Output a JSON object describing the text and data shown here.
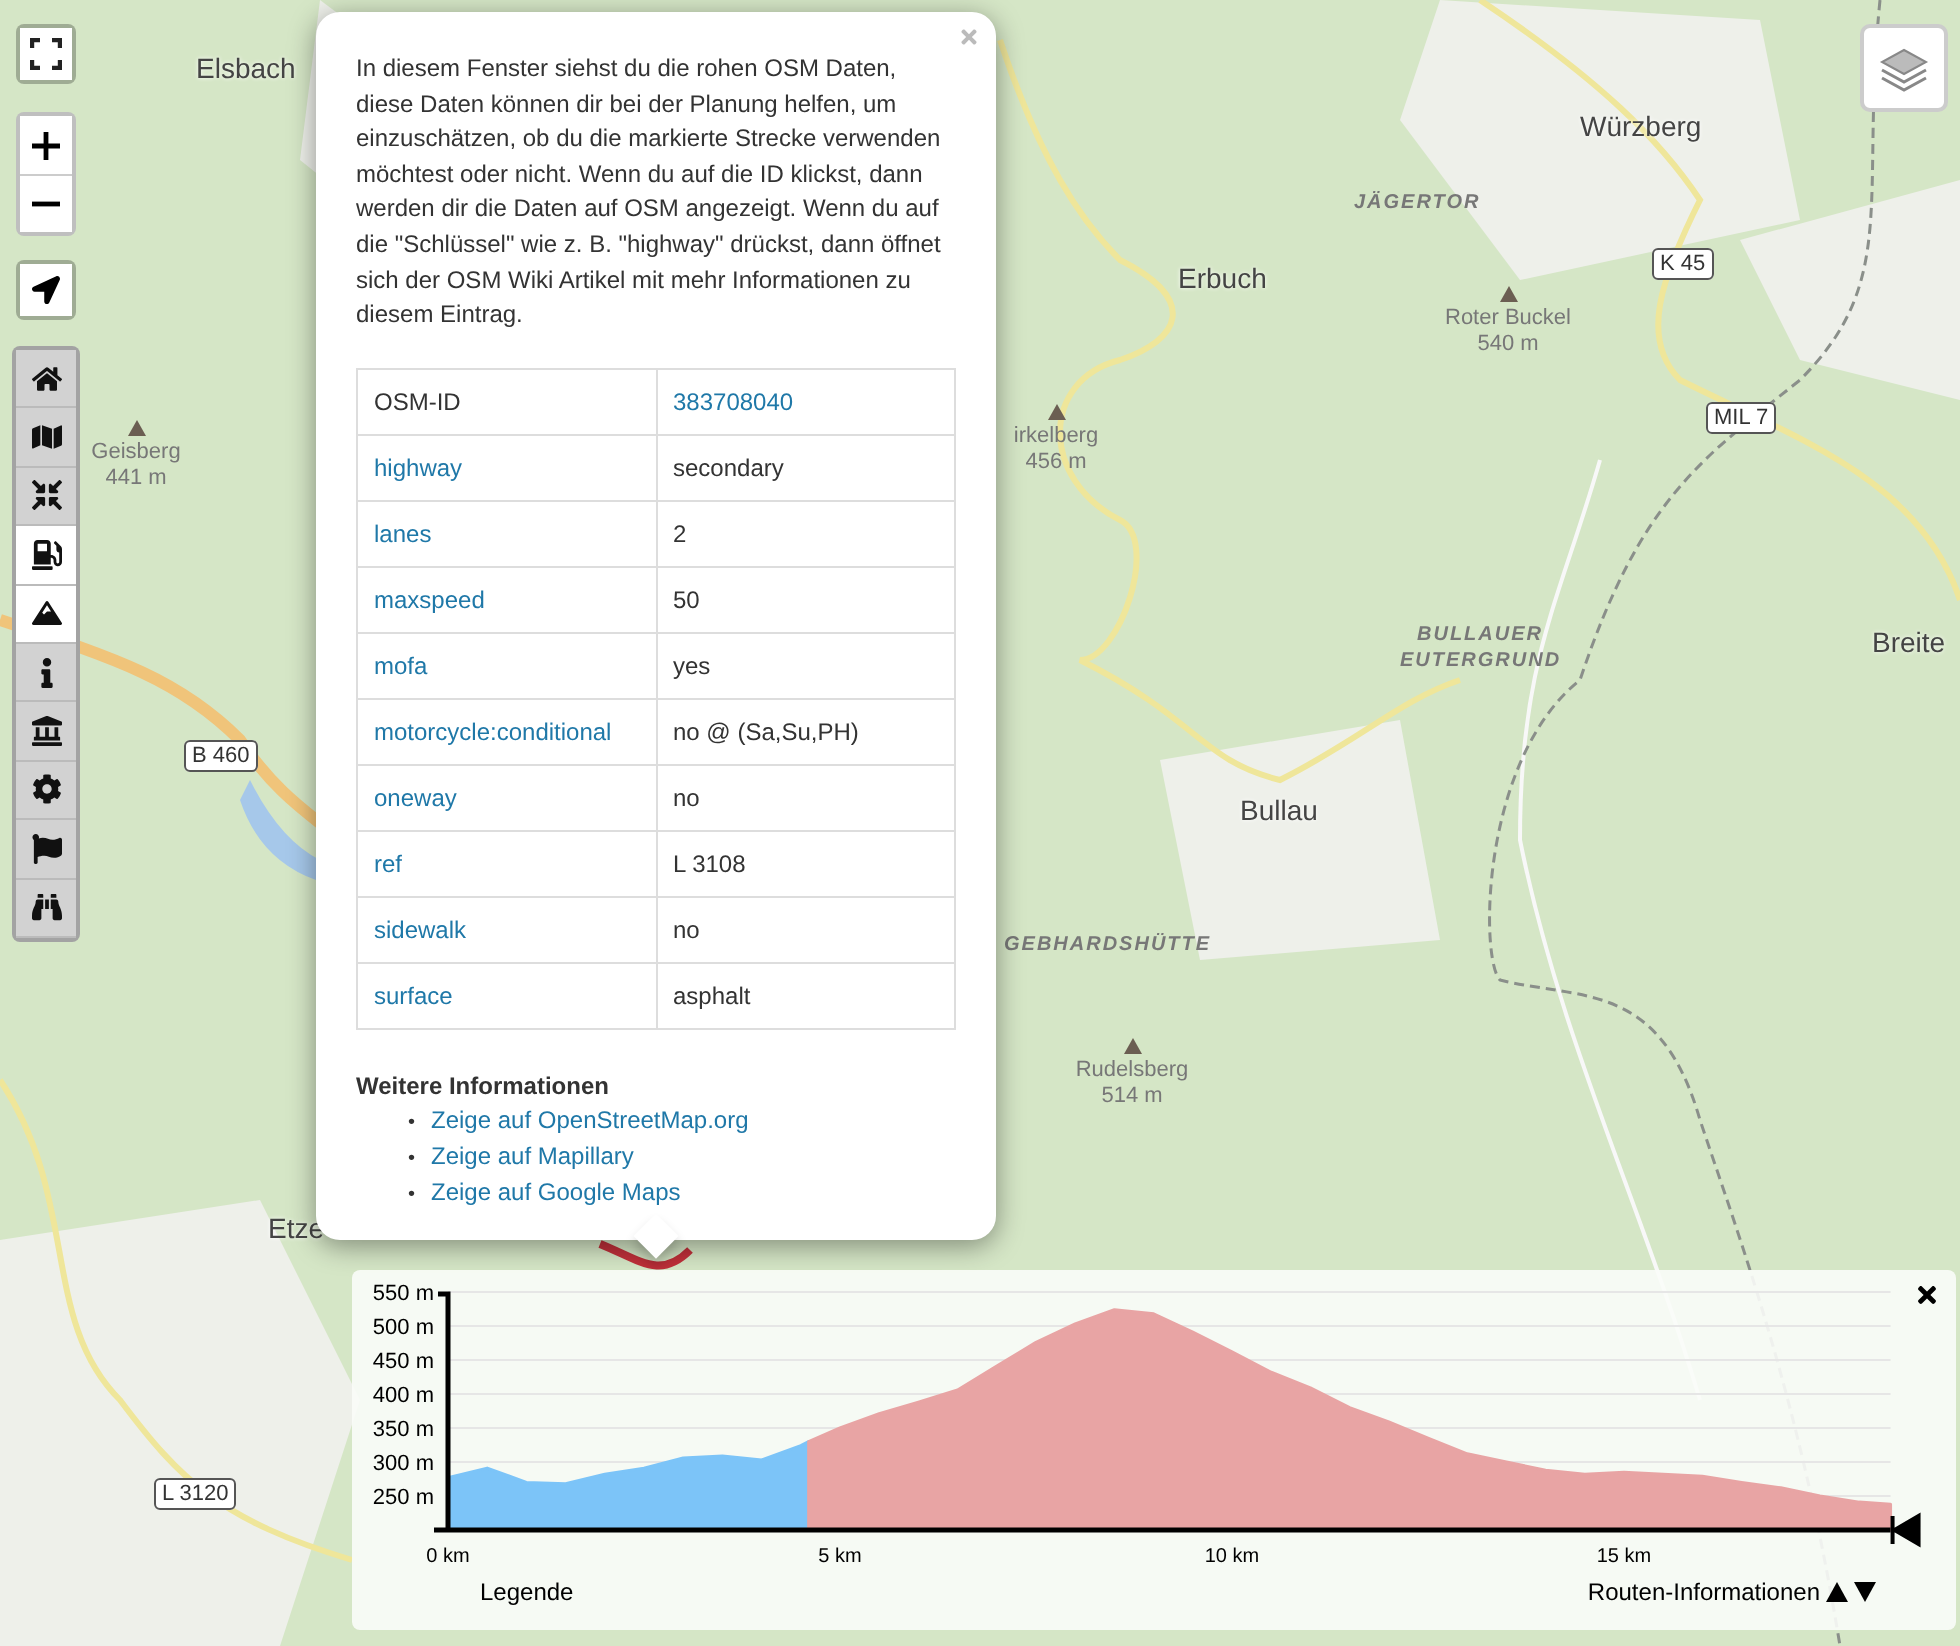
{
  "map": {
    "labels": [
      {
        "kind": "place",
        "text": "Elsbach"
      },
      {
        "kind": "peak",
        "text": "Geisberg",
        "elevation": "441 m"
      },
      {
        "kind": "road",
        "text": "B 460"
      },
      {
        "kind": "place",
        "text": "Etze"
      },
      {
        "kind": "road",
        "text": "L 3120"
      },
      {
        "kind": "place",
        "text": "Erbuch"
      },
      {
        "kind": "peak",
        "text": "irkelberg",
        "elevation": "456 m"
      },
      {
        "kind": "place",
        "text": "Würzberg"
      },
      {
        "kind": "area",
        "text": "JÄGERTOR"
      },
      {
        "kind": "peak",
        "text": "Roter Buckel",
        "elevation": "540 m"
      },
      {
        "kind": "road",
        "text": "K 45"
      },
      {
        "kind": "road",
        "text": "MIL 7"
      },
      {
        "kind": "place",
        "text": "Breite"
      },
      {
        "kind": "area",
        "text": "BULLAUER EUTERGRUND"
      },
      {
        "kind": "place",
        "text": "Bullau"
      },
      {
        "kind": "area",
        "text": "GEBHARDSHÜTTE"
      },
      {
        "kind": "peak",
        "text": "Rudelsberg",
        "elevation": "514 m"
      }
    ]
  },
  "tools": [
    {
      "kind": "home",
      "selected": false
    },
    {
      "kind": "map",
      "selected": false
    },
    {
      "kind": "compress",
      "selected": false
    },
    {
      "kind": "fuel",
      "selected": true
    },
    {
      "kind": "mountain",
      "selected": true
    },
    {
      "kind": "info",
      "selected": false
    },
    {
      "kind": "landmark",
      "selected": false
    },
    {
      "kind": "settings",
      "selected": false
    },
    {
      "kind": "flag",
      "selected": false
    },
    {
      "kind": "binoculars",
      "selected": false
    }
  ],
  "popup": {
    "intro": "In diesem Fenster siehst du die rohen OSM Daten, diese Daten können dir bei der Planung helfen, um einzuschätzen, ob du die markierte Strecke verwenden möchtest oder nicht. Wenn du auf die ID klickst, dann werden dir die Daten auf OSM angezeigt. Wenn du auf die \"Schlüssel\" wie z. B. \"highway\" drückst, dann öffnet sich der OSM Wiki Artikel mit mehr Informationen zu diesem Eintrag.",
    "rows": [
      {
        "key": "OSM-ID",
        "value": "383708040",
        "key_link": false,
        "value_link": true
      },
      {
        "key": "highway",
        "value": "secondary",
        "key_link": true,
        "value_link": false
      },
      {
        "key": "lanes",
        "value": "2",
        "key_link": true,
        "value_link": false
      },
      {
        "key": "maxspeed",
        "value": "50",
        "key_link": true,
        "value_link": false
      },
      {
        "key": "mofa",
        "value": "yes",
        "key_link": true,
        "value_link": false
      },
      {
        "key": "motorcycle:conditional",
        "value": "no @ (Sa,Su,PH)",
        "key_link": true,
        "value_link": false
      },
      {
        "key": "oneway",
        "value": "no",
        "key_link": true,
        "value_link": false
      },
      {
        "key": "ref",
        "value": "L 3108",
        "key_link": true,
        "value_link": false
      },
      {
        "key": "sidewalk",
        "value": "no",
        "key_link": true,
        "value_link": false
      },
      {
        "key": "surface",
        "value": "asphalt",
        "key_link": true,
        "value_link": false
      }
    ],
    "more_title": "Weitere Informationen",
    "links": [
      {
        "bullet": "•",
        "text": "Zeige auf OpenStreetMap.org"
      },
      {
        "bullet": "•",
        "text": "Zeige auf Mapillary"
      },
      {
        "bullet": "•",
        "text": "Zeige auf Google Maps"
      }
    ]
  },
  "elevation": {
    "legend": "Legende",
    "route_info": "Routen-Informationen",
    "chart_data": {
      "type": "area",
      "grid": true,
      "xlim": [
        0,
        18.4
      ],
      "ylim": [
        200,
        550
      ],
      "x": [
        0,
        0.5,
        1,
        1.5,
        2,
        2.5,
        3,
        3.5,
        4,
        4.5,
        4.6,
        5,
        5.5,
        6,
        6.5,
        7,
        7.5,
        8,
        8.5,
        9,
        9.5,
        10,
        10.5,
        11,
        11.5,
        12,
        12.5,
        13,
        13.5,
        14,
        14.5,
        15,
        15.5,
        16,
        16.5,
        17,
        17.5,
        18,
        18.4
      ],
      "series": [
        {
          "color": "#7cc4f8",
          "values": [
            277,
            291,
            270,
            268,
            282,
            291,
            306,
            309,
            303,
            324,
            330,
            null,
            null,
            null,
            null,
            null,
            null,
            null,
            null,
            null,
            null,
            null,
            null,
            null,
            null,
            null,
            null,
            null,
            null,
            null,
            null,
            null,
            null,
            null,
            null,
            null,
            null,
            null,
            null
          ]
        },
        {
          "color": "#e8a4a4",
          "values": [
            null,
            null,
            null,
            null,
            null,
            null,
            null,
            null,
            null,
            null,
            330,
            350,
            371,
            388,
            406,
            441,
            476,
            503,
            524,
            518,
            491,
            462,
            432,
            409,
            380,
            359,
            335,
            312,
            300,
            288,
            282,
            285,
            282,
            279,
            270,
            262,
            250,
            241,
            238
          ]
        }
      ],
      "xticks": [
        {
          "value": 0,
          "label": "0 km"
        },
        {
          "value": 5,
          "label": "5 km"
        },
        {
          "value": 10,
          "label": "10 km"
        },
        {
          "value": 15,
          "label": "15 km"
        }
      ],
      "yticks": [
        {
          "value": 250,
          "label": "250 m"
        },
        {
          "value": 300,
          "label": "300 m"
        },
        {
          "value": 350,
          "label": "350 m"
        },
        {
          "value": 400,
          "label": "400 m"
        },
        {
          "value": 450,
          "label": "450 m"
        },
        {
          "value": 500,
          "label": "500 m"
        },
        {
          "value": 550,
          "label": "550 m"
        }
      ]
    }
  }
}
